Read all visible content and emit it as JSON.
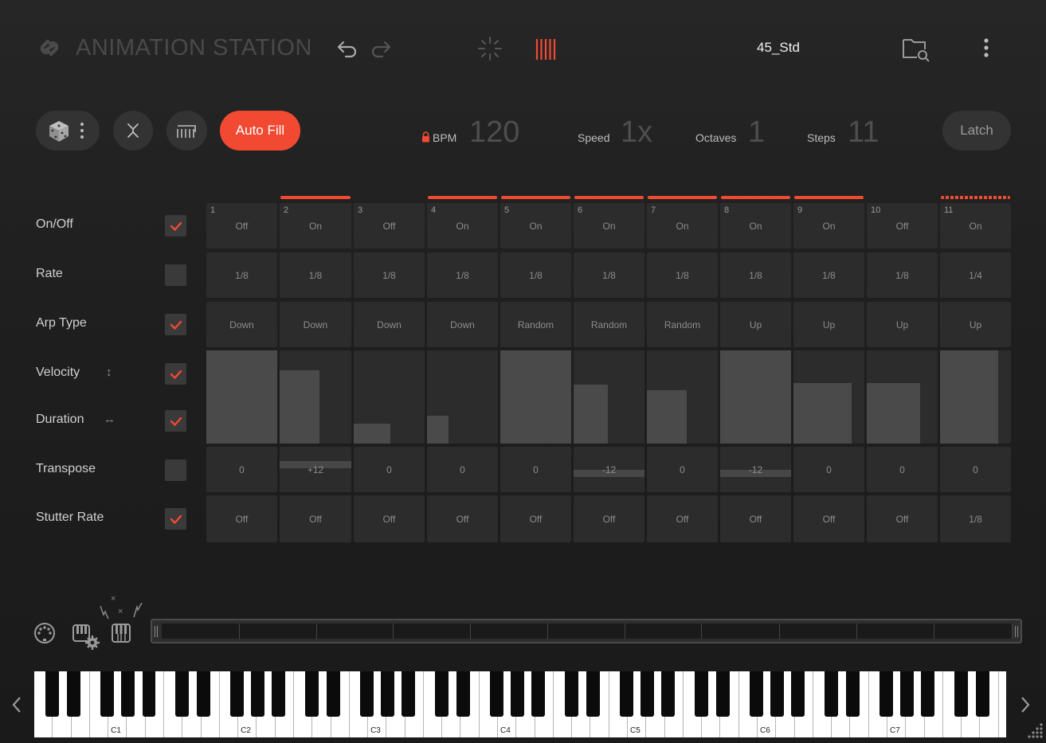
{
  "header": {
    "app_title": "ANIMATION STATION",
    "preset_name": "45_Std"
  },
  "toolbar": {
    "autofill_label": "Auto Fill",
    "latch_label": "Latch",
    "bpm_label": "BPM",
    "bpm_value": "120",
    "speed_label": "Speed",
    "speed_value": "1x",
    "octaves_label": "Octaves",
    "octaves_value": "1",
    "steps_label": "Steps",
    "steps_value": "11"
  },
  "rows": [
    {
      "label": "On/Off",
      "checked": true
    },
    {
      "label": "Rate",
      "checked": false
    },
    {
      "label": "Arp Type",
      "checked": true
    },
    {
      "label": "Velocity",
      "checked": true,
      "aux_icon": "↕"
    },
    {
      "label": "Duration",
      "checked": true,
      "aux_icon": "↔"
    },
    {
      "label": "Transpose",
      "checked": false
    },
    {
      "label": "Stutter Rate",
      "checked": true
    }
  ],
  "steps": [
    {
      "num": "1",
      "active": false,
      "onoff": "Off",
      "rate": "1/8",
      "arp": "Down",
      "velocity": 1.0,
      "duration": 1.0,
      "transpose": "0",
      "trans_level": 0,
      "stutter": "Off"
    },
    {
      "num": "2",
      "active": true,
      "onoff": "On",
      "rate": "1/8",
      "arp": "Down",
      "velocity": 0.79,
      "duration": 0.55,
      "transpose": "+12",
      "trans_level": 1,
      "stutter": "Off"
    },
    {
      "num": "3",
      "active": false,
      "onoff": "Off",
      "rate": "1/8",
      "arp": "Down",
      "velocity": 0.21,
      "duration": 0.52,
      "transpose": "0",
      "trans_level": 0,
      "stutter": "Off"
    },
    {
      "num": "4",
      "active": true,
      "onoff": "On",
      "rate": "1/8",
      "arp": "Down",
      "velocity": 0.3,
      "duration": 0.3,
      "transpose": "0",
      "trans_level": 0,
      "stutter": "Off"
    },
    {
      "num": "5",
      "active": true,
      "onoff": "On",
      "rate": "1/8",
      "arp": "Random",
      "velocity": 1.0,
      "duration": 1.0,
      "transpose": "0",
      "trans_level": 0,
      "stutter": "Off"
    },
    {
      "num": "6",
      "active": true,
      "onoff": "On",
      "rate": "1/8",
      "arp": "Random",
      "velocity": 0.63,
      "duration": 0.48,
      "transpose": "-12",
      "trans_level": -1,
      "stutter": "Off"
    },
    {
      "num": "7",
      "active": true,
      "onoff": "On",
      "rate": "1/8",
      "arp": "Random",
      "velocity": 0.57,
      "duration": 0.56,
      "transpose": "0",
      "trans_level": 0,
      "stutter": "Off"
    },
    {
      "num": "8",
      "active": true,
      "onoff": "On",
      "rate": "1/8",
      "arp": "Up",
      "velocity": 1.0,
      "duration": 1.0,
      "transpose": "-12",
      "trans_level": -1,
      "stutter": "Off"
    },
    {
      "num": "9",
      "active": true,
      "onoff": "On",
      "rate": "1/8",
      "arp": "Up",
      "velocity": 0.65,
      "duration": 0.82,
      "transpose": "0",
      "trans_level": 0,
      "stutter": "Off"
    },
    {
      "num": "10",
      "active": false,
      "onoff": "Off",
      "rate": "1/8",
      "arp": "Up",
      "velocity": 0.65,
      "duration": 0.75,
      "transpose": "0",
      "trans_level": 0,
      "stutter": "Off"
    },
    {
      "num": "11",
      "active": true,
      "onoff": "On",
      "rate": "1/4",
      "arp": "Up",
      "velocity": 1.0,
      "duration": 0.82,
      "transpose": "0",
      "trans_level": 0,
      "stutter": "1/8",
      "dashed": true
    }
  ],
  "keyboard": {
    "octave_labels": [
      "C1",
      "C2",
      "C3",
      "C4",
      "C5",
      "C6",
      "C7"
    ]
  },
  "colors": {
    "accent": "#f24a32",
    "cell": "#2c2c2c",
    "bar": "#4a4a4a"
  }
}
